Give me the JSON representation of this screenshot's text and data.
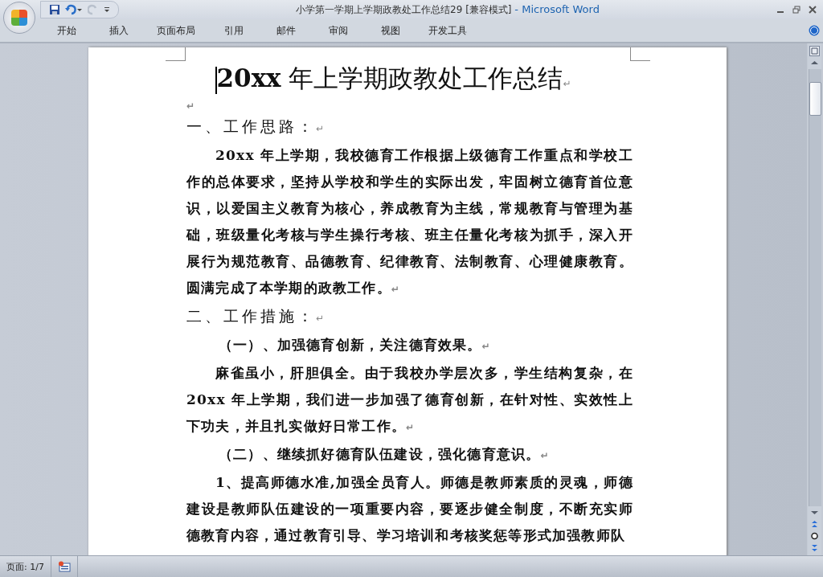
{
  "window": {
    "title": "小学第一学期上学期政教处工作总结29 [兼容模式]",
    "app_name": "- Microsoft Word"
  },
  "ribbon_tabs": [
    {
      "label": "开始",
      "selected": false
    },
    {
      "label": "插入",
      "selected": false
    },
    {
      "label": "页面布局",
      "selected": false
    },
    {
      "label": "引用",
      "selected": false
    },
    {
      "label": "邮件",
      "selected": false
    },
    {
      "label": "审阅",
      "selected": false
    },
    {
      "label": "视图",
      "selected": false
    },
    {
      "label": "开发工具",
      "selected": false
    }
  ],
  "document": {
    "title_bold": "20xx",
    "title_rest": " 年上学期政教处工作总结",
    "paragraph_mark": "↵",
    "paragraphs": [
      {
        "kind": "empty"
      },
      {
        "kind": "heading",
        "text": "一、工作思路："
      },
      {
        "kind": "body",
        "text": "20xx 年上学期，我校德育工作根据上级德育工作重点和学校工作的总体要求，坚持从学校和学生的实际出发，牢固树立德育首位意识，以爱国主义教育为核心，养成教育为主线，常规教育与管理为基础，班级量化考核与学生操行考核、班主任量化考核为抓手，深入开展行为规范教育、品德教育、纪律教育、法制教育、心理健康教育。圆满完成了本学期的政教工作。"
      },
      {
        "kind": "heading",
        "text": "二、工作措施："
      },
      {
        "kind": "subheading",
        "text": "（一）、加强德育创新，关注德育效果。"
      },
      {
        "kind": "body",
        "text": "麻雀虽小，肝胆俱全。由于我校办学层次多，学生结构复杂，在 20xx 年上学期，我们进一步加强了德育创新，在针对性、实效性上下功夫，并且扎实做好日常工作。"
      },
      {
        "kind": "subheading",
        "text": "（二）、继续抓好德育队伍建设，强化德育意识。"
      },
      {
        "kind": "body_open",
        "text": "1、提高师德水准,加强全员育人。师德是教师素质的灵魂，师德建设是教师队伍建设的一项重要内容，要逐步健全制度，不断充实师德教育内容，通过教育引导、学习培训和考核奖惩等形式加强教师队"
      }
    ]
  },
  "status_bar": {
    "page": "页面: 1/7"
  }
}
